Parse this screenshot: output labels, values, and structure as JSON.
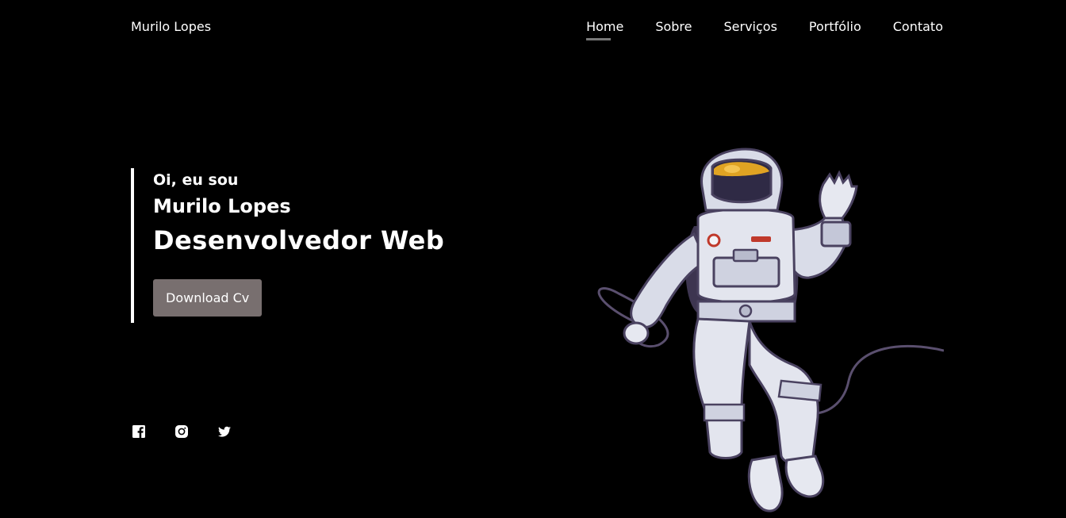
{
  "header": {
    "brand": "Murilo Lopes",
    "nav": [
      {
        "label": "Home",
        "active": true
      },
      {
        "label": "Sobre"
      },
      {
        "label": "Serviços"
      },
      {
        "label": "Portfólio"
      },
      {
        "label": "Contato"
      }
    ]
  },
  "hero": {
    "greeting": "Oi, eu sou",
    "name": "Murilo Lopes",
    "role": "Desenvolvedor Web",
    "cv_button": "Download Cv"
  },
  "social": [
    {
      "icon": "facebook-icon"
    },
    {
      "icon": "instagram-icon"
    },
    {
      "icon": "twitter-icon"
    }
  ],
  "illustration": {
    "icon": "astronaut-illustration"
  },
  "colors": {
    "background": "#000000",
    "button": "#786f6f",
    "nav_underline": "#777777"
  }
}
